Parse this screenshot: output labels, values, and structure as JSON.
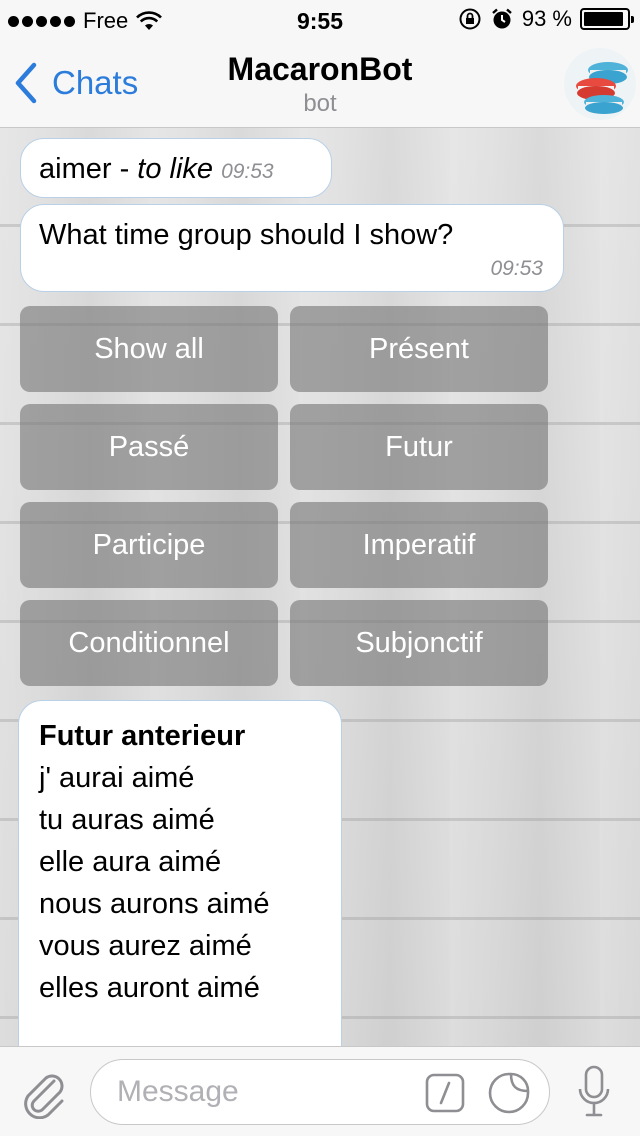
{
  "status_bar": {
    "carrier": "Free",
    "time": "9:55",
    "battery_text": "93 %",
    "battery_level": 0.93,
    "icons": [
      "signal-dots-icon",
      "wifi-icon",
      "orientation-lock-icon",
      "alarm-icon",
      "battery-icon"
    ]
  },
  "nav": {
    "back_label": "Chats",
    "title": "MacaronBot",
    "subtitle": "bot",
    "accent_color": "#2c7cdb"
  },
  "messages": {
    "verb": {
      "text": "aimer - ",
      "translation": "to like",
      "time": "09:53"
    },
    "question": {
      "text": "What time group should I show?",
      "time": "09:53"
    },
    "conjugation": {
      "heading": "Futur anterieur",
      "lines": [
        "j' aurai aimé",
        "tu auras aimé",
        "elle aura aimé",
        "nous aurons aimé",
        "vous aurez aimé",
        "elles auront aimé"
      ]
    }
  },
  "keyboard": {
    "buttons": [
      "Show all",
      "Présent",
      "Passé",
      "Futur",
      "Participe",
      "Imperatif",
      "Conditionnel",
      "Subjonctif"
    ]
  },
  "input": {
    "placeholder": "Message",
    "value": ""
  }
}
